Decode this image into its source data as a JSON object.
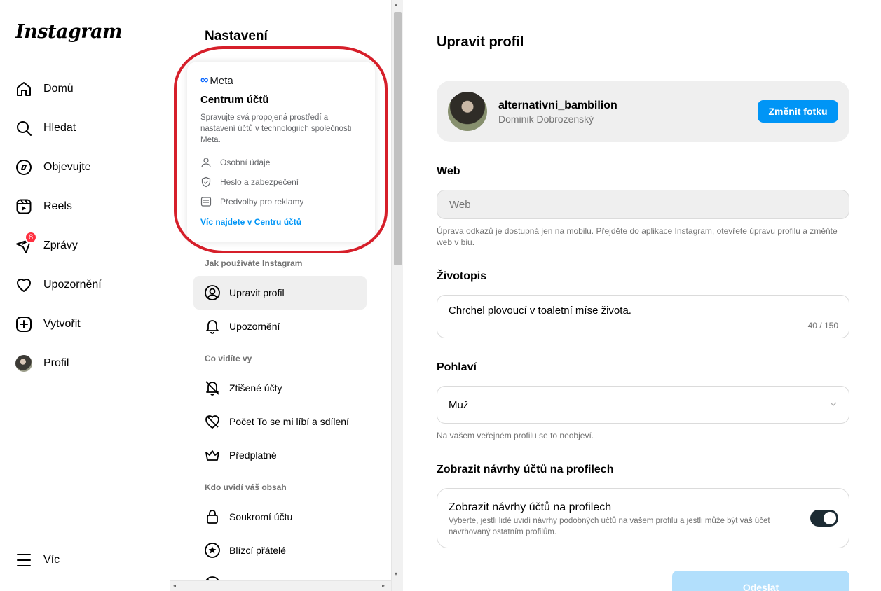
{
  "app": {
    "logo": "Instagram"
  },
  "nav": {
    "items": [
      {
        "label": "Domů",
        "icon": "home-icon"
      },
      {
        "label": "Hledat",
        "icon": "search-icon"
      },
      {
        "label": "Objevujte",
        "icon": "compass-icon"
      },
      {
        "label": "Reels",
        "icon": "reels-icon"
      },
      {
        "label": "Zprávy",
        "icon": "messages-icon",
        "badge": "8"
      },
      {
        "label": "Upozornění",
        "icon": "heart-icon"
      },
      {
        "label": "Vytvořit",
        "icon": "create-icon"
      },
      {
        "label": "Profil",
        "icon": "avatar"
      }
    ],
    "more_label": "Víc"
  },
  "settings": {
    "title": "Nastavení",
    "accounts_center": {
      "brand": "Meta",
      "title": "Centrum účtů",
      "description": "Spravujte svá propojená prostředí a nastavení účtů v technologiích společnosti Meta.",
      "rows": [
        "Osobní údaje",
        "Heslo a zabezpečení",
        "Předvolby pro reklamy"
      ],
      "link": "Víc najdete v Centru účtů",
      "highlight_color": "#d61f2a"
    },
    "sections": [
      {
        "heading": "Jak používáte Instagram",
        "items": [
          "Upravit profil",
          "Upozornění"
        ]
      },
      {
        "heading": "Co vidíte vy",
        "items": [
          "Ztišené účty",
          "Počet To se mi líbí a sdílení",
          "Předplatné"
        ]
      },
      {
        "heading": "Kdo uvidí váš obsah",
        "items": [
          "Soukromí účtu",
          "Blízcí přátelé"
        ]
      }
    ]
  },
  "main": {
    "title": "Upravit profil",
    "profile": {
      "username": "alternativni_bambilion",
      "full_name": "Dominik Dobrozenský",
      "change_photo_label": "Změnit fotku"
    },
    "web": {
      "label": "Web",
      "placeholder": "Web",
      "hint": "Úprava odkazů je dostupná jen na mobilu. Přejděte do aplikace Instagram, otevřete úpravu profilu a změňte web v biu."
    },
    "bio": {
      "label": "Životopis",
      "value": "Chrchel plovoucí v toaletní míse života.",
      "counter": "40 / 150"
    },
    "gender": {
      "label": "Pohlaví",
      "value": "Muž",
      "hint": "Na vašem veřejném profilu se to neobjeví."
    },
    "suggestions": {
      "label": "Zobrazit návrhy účtů na profilech",
      "title": "Zobrazit návrhy účtů na profilech",
      "description": "Vyberte, jestli lidé uvidí návrhy podobných účtů na vašem profilu a jestli může být váš účet navrhovaný ostatním profilům.",
      "enabled": true
    },
    "submit_label": "Odeslat"
  },
  "colors": {
    "accent": "#0095f6",
    "badge": "#ff3040",
    "toggle_on": "#1c2b33"
  }
}
